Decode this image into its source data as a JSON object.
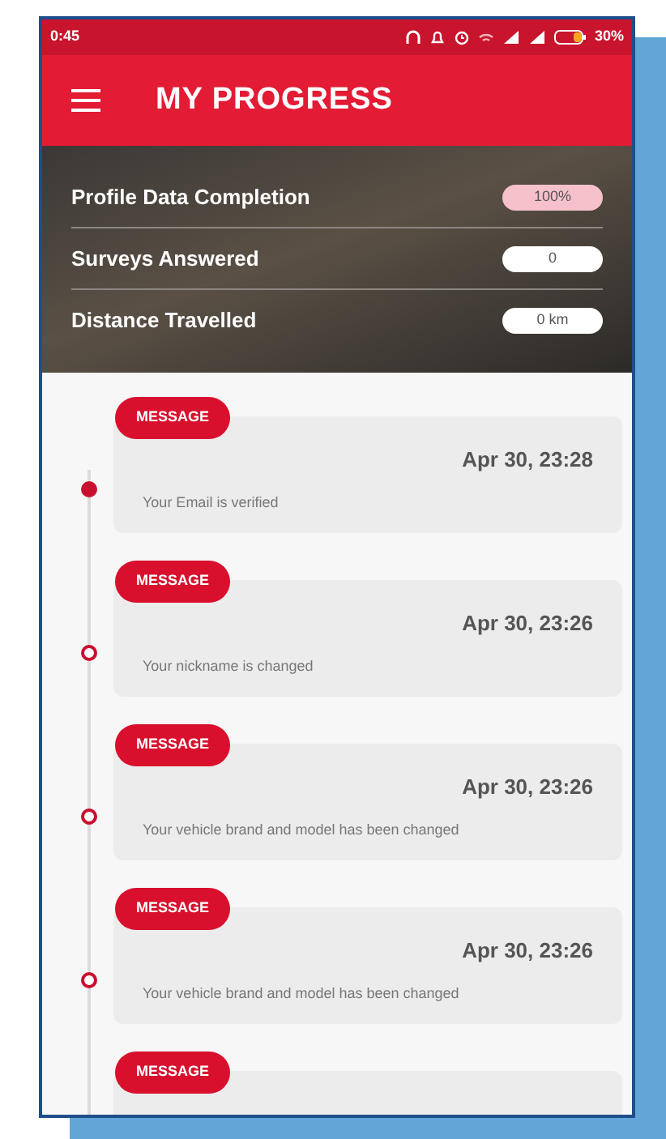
{
  "status_bar": {
    "time": "0:45",
    "battery": "30%"
  },
  "app_bar": {
    "title": "MY PROGRESS"
  },
  "stats": [
    {
      "label": "Profile Data Completion",
      "value": "100%",
      "highlighted": true
    },
    {
      "label": "Surveys Answered",
      "value": "0",
      "highlighted": false
    },
    {
      "label": "Distance Travelled",
      "value": "0 km",
      "highlighted": false
    }
  ],
  "timeline": [
    {
      "badge": "MESSAGE",
      "date": "Apr 30, 23:28",
      "text": "Your Email is verified",
      "current": true
    },
    {
      "badge": "MESSAGE",
      "date": "Apr 30, 23:26",
      "text": "Your nickname is changed",
      "current": false
    },
    {
      "badge": "MESSAGE",
      "date": "Apr 30, 23:26",
      "text": "Your vehicle brand and model has been changed",
      "current": false
    },
    {
      "badge": "MESSAGE",
      "date": "Apr 30, 23:26",
      "text": "Your vehicle brand and model has been changed",
      "current": false
    },
    {
      "badge": "MESSAGE"
    }
  ]
}
